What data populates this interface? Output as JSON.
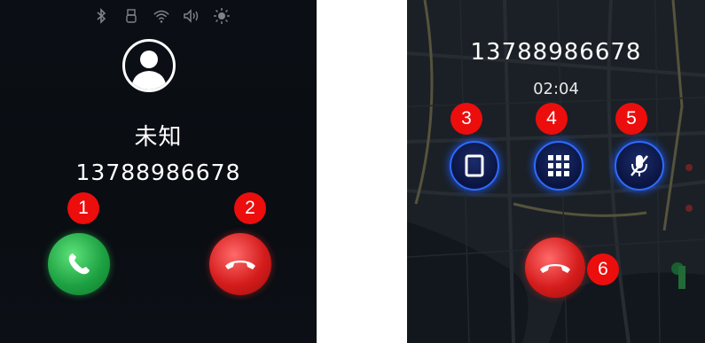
{
  "incoming": {
    "status_icons": [
      "bluetooth-icon",
      "usb-icon",
      "wifi-icon",
      "volume-icon",
      "brightness-icon"
    ],
    "caller_name": "未知",
    "caller_number": "13788986678",
    "badges": [
      "1",
      "2"
    ],
    "answer_color": "#1ea243",
    "hangup_color": "#d51c1c"
  },
  "active": {
    "caller_number": "13788986678",
    "timer": "02:04",
    "controls": [
      "handset-icon",
      "dialpad-icon",
      "mute-mic-icon"
    ],
    "badges": [
      "3",
      "4",
      "5",
      "6"
    ],
    "accent": "#2e6bff"
  },
  "badge_color": "#ec0d0d"
}
